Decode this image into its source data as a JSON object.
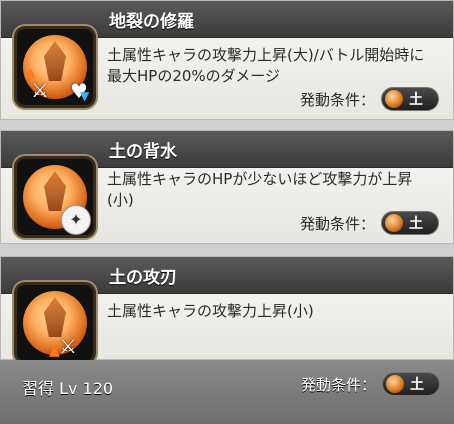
{
  "skills": [
    {
      "title": "地裂の修羅",
      "desc": "土属性キャラの攻撃力上昇(大)/バトル開始時に最大HPの20%のダメージ",
      "cond_label": "発動条件：",
      "element": "土",
      "icon": "earth-crystal-icon",
      "badges": [
        "sword-icon",
        "heart-icon",
        "up-arrow-icon",
        "down-arrow-icon"
      ]
    },
    {
      "title": "土の背水",
      "desc": "土属性キャラのHPが少ないほど攻撃力が上昇(小)",
      "cond_label": "発動条件：",
      "element": "土",
      "icon": "earth-crystal-icon",
      "badges": [
        "claw-icon"
      ]
    },
    {
      "title": "土の攻刃",
      "desc": "土属性キャラの攻撃力上昇(小)",
      "cond_label": "発動条件：",
      "element": "土",
      "icon": "earth-crystal-icon",
      "badges": [
        "sword-icon",
        "up-arrow-icon"
      ]
    }
  ],
  "footer": {
    "learn_text": "習得 Lv 120",
    "cond_label": "発動条件：",
    "element": "土"
  }
}
